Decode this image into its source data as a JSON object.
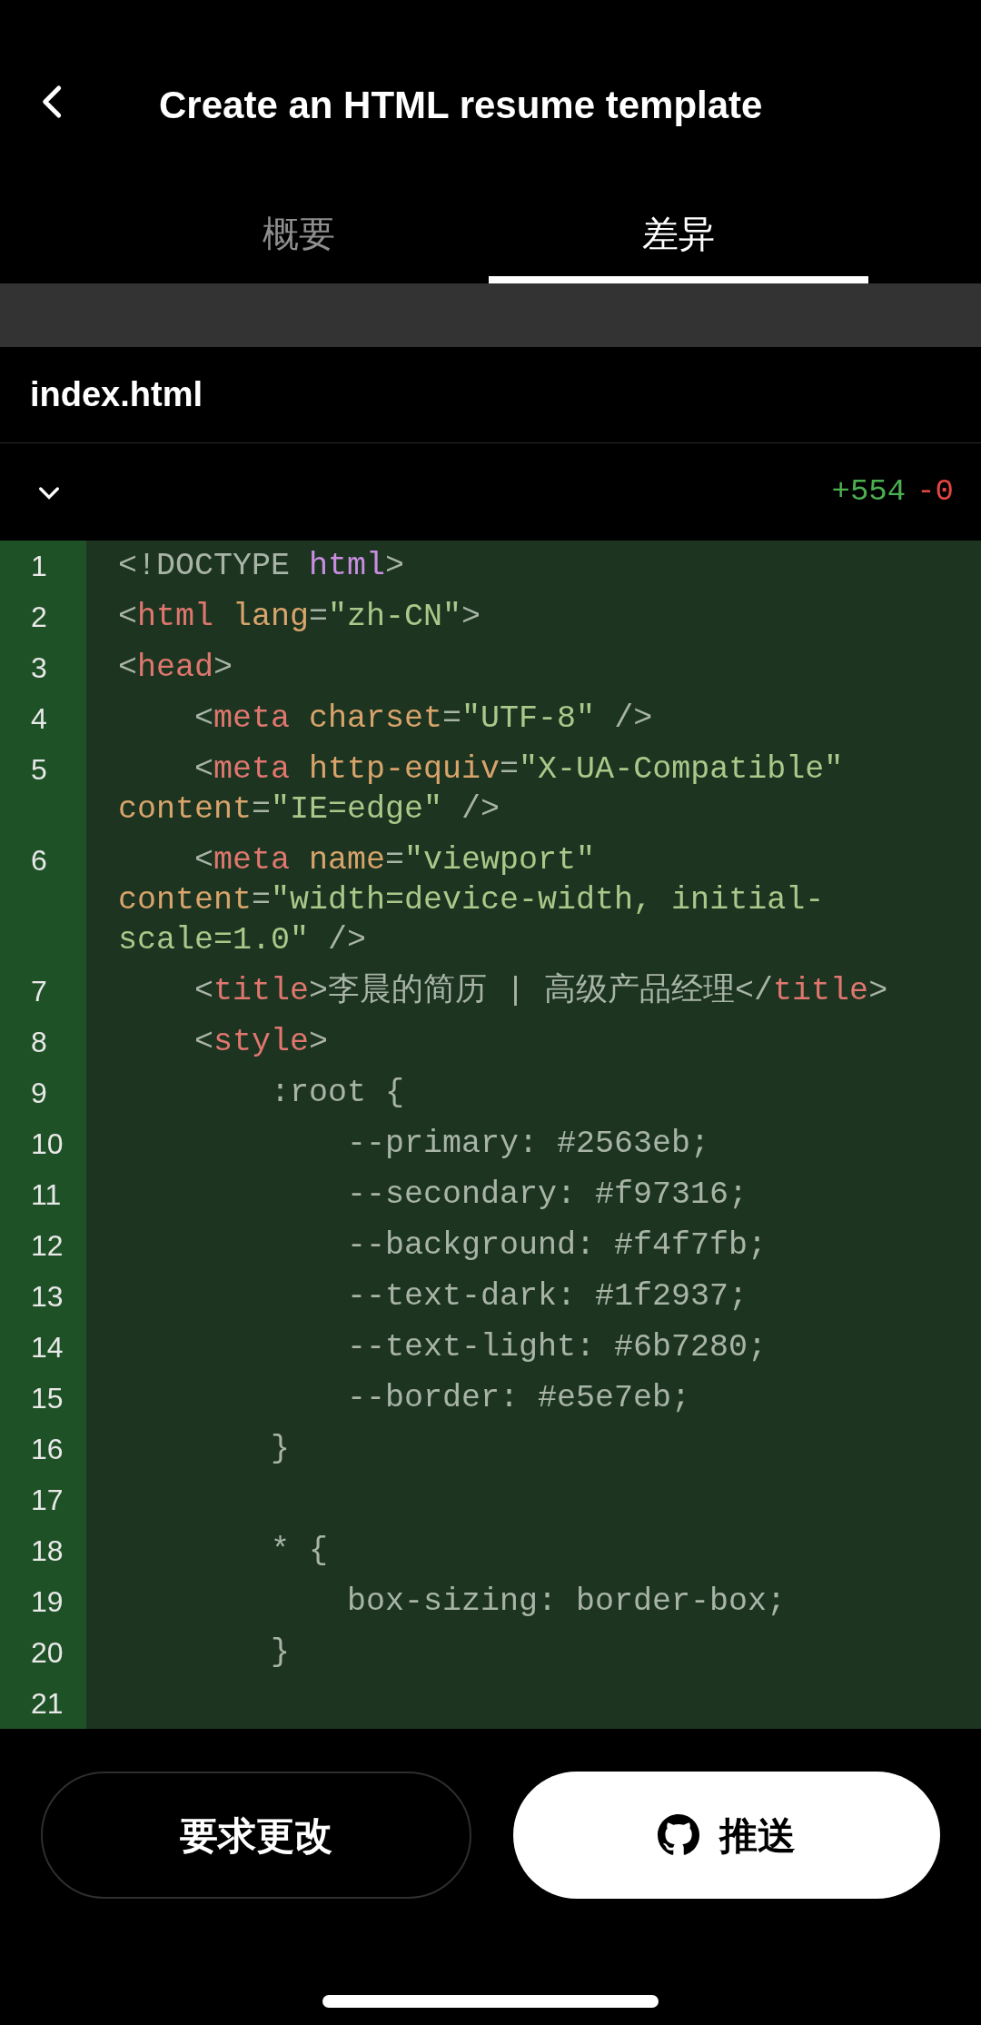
{
  "header": {
    "title": "Create an HTML resume template"
  },
  "tabs": [
    {
      "label": "概要",
      "selected": false
    },
    {
      "label": "差异",
      "selected": true
    }
  ],
  "file": {
    "name": "index.html",
    "expanded": true,
    "additions": "+554",
    "deletions": "-0"
  },
  "code": [
    {
      "number": "1",
      "tokens": [
        {
          "kind": "plain",
          "text": "<!DOCTYPE "
        },
        {
          "kind": "keyword",
          "text": "html"
        },
        {
          "kind": "punct",
          "text": ">"
        }
      ]
    },
    {
      "number": "2",
      "tokens": [
        {
          "kind": "punct",
          "text": "<"
        },
        {
          "kind": "tag",
          "text": "html"
        },
        {
          "kind": "attr",
          "text": " lang"
        },
        {
          "kind": "punct",
          "text": "="
        },
        {
          "kind": "string",
          "text": "\"zh-CN\""
        },
        {
          "kind": "punct",
          "text": ">"
        }
      ]
    },
    {
      "number": "3",
      "tokens": [
        {
          "kind": "punct",
          "text": "<"
        },
        {
          "kind": "tag",
          "text": "head"
        },
        {
          "kind": "punct",
          "text": ">"
        }
      ]
    },
    {
      "number": "4",
      "tokens": [
        {
          "kind": "punct",
          "text": "    <"
        },
        {
          "kind": "tag",
          "text": "meta"
        },
        {
          "kind": "attr",
          "text": " charset"
        },
        {
          "kind": "punct",
          "text": "="
        },
        {
          "kind": "string",
          "text": "\"UTF-8\""
        },
        {
          "kind": "punct",
          "text": " />"
        }
      ]
    },
    {
      "number": "5",
      "tokens": [
        {
          "kind": "punct",
          "text": "    <"
        },
        {
          "kind": "tag",
          "text": "meta"
        },
        {
          "kind": "attr",
          "text": " http-equiv"
        },
        {
          "kind": "punct",
          "text": "="
        },
        {
          "kind": "string",
          "text": "\"X-UA-Compatible\""
        },
        {
          "kind": "attr",
          "text": " content"
        },
        {
          "kind": "punct",
          "text": "="
        },
        {
          "kind": "string",
          "text": "\"IE=edge\""
        },
        {
          "kind": "punct",
          "text": " />"
        }
      ]
    },
    {
      "number": "6",
      "tokens": [
        {
          "kind": "punct",
          "text": "    <"
        },
        {
          "kind": "tag",
          "text": "meta"
        },
        {
          "kind": "attr",
          "text": " name"
        },
        {
          "kind": "punct",
          "text": "="
        },
        {
          "kind": "string",
          "text": "\"viewport\""
        },
        {
          "kind": "attr",
          "text": " content"
        },
        {
          "kind": "punct",
          "text": "="
        },
        {
          "kind": "string",
          "text": "\"width=device-width, initial-scale=1.0\""
        },
        {
          "kind": "punct",
          "text": " />"
        }
      ]
    },
    {
      "number": "7",
      "tokens": [
        {
          "kind": "punct",
          "text": "    <"
        },
        {
          "kind": "tag",
          "text": "title"
        },
        {
          "kind": "punct",
          "text": ">"
        },
        {
          "kind": "plain",
          "text": "李晨的简历 | 高级产品经理"
        },
        {
          "kind": "punct",
          "text": "</"
        },
        {
          "kind": "tag",
          "text": "title"
        },
        {
          "kind": "punct",
          "text": ">"
        }
      ]
    },
    {
      "number": "8",
      "tokens": [
        {
          "kind": "punct",
          "text": "    <"
        },
        {
          "kind": "tag",
          "text": "style"
        },
        {
          "kind": "punct",
          "text": ">"
        }
      ]
    },
    {
      "number": "9",
      "tokens": [
        {
          "kind": "plain",
          "text": "        :root {"
        }
      ]
    },
    {
      "number": "10",
      "tokens": [
        {
          "kind": "plain",
          "text": "            --primary: #2563eb;"
        }
      ]
    },
    {
      "number": "11",
      "tokens": [
        {
          "kind": "plain",
          "text": "            --secondary: #f97316;"
        }
      ]
    },
    {
      "number": "12",
      "tokens": [
        {
          "kind": "plain",
          "text": "            --background: #f4f7fb;"
        }
      ]
    },
    {
      "number": "13",
      "tokens": [
        {
          "kind": "plain",
          "text": "            --text-dark: #1f2937;"
        }
      ]
    },
    {
      "number": "14",
      "tokens": [
        {
          "kind": "plain",
          "text": "            --text-light: #6b7280;"
        }
      ]
    },
    {
      "number": "15",
      "tokens": [
        {
          "kind": "plain",
          "text": "            --border: #e5e7eb;"
        }
      ]
    },
    {
      "number": "16",
      "tokens": [
        {
          "kind": "plain",
          "text": "        }"
        }
      ]
    },
    {
      "number": "17"
    },
    {
      "number": "18",
      "tokens": [
        {
          "kind": "plain",
          "text": "        * {"
        }
      ]
    },
    {
      "number": "19",
      "tokens": [
        {
          "kind": "plain",
          "text": "            box-sizing: border-box;"
        }
      ]
    },
    {
      "number": "20",
      "tokens": [
        {
          "kind": "plain",
          "text": "        }"
        }
      ]
    },
    {
      "number": "21"
    }
  ],
  "buttons": [
    {
      "label": "要求更改",
      "kind": "outline"
    },
    {
      "label": "推送",
      "kind": "github"
    }
  ]
}
